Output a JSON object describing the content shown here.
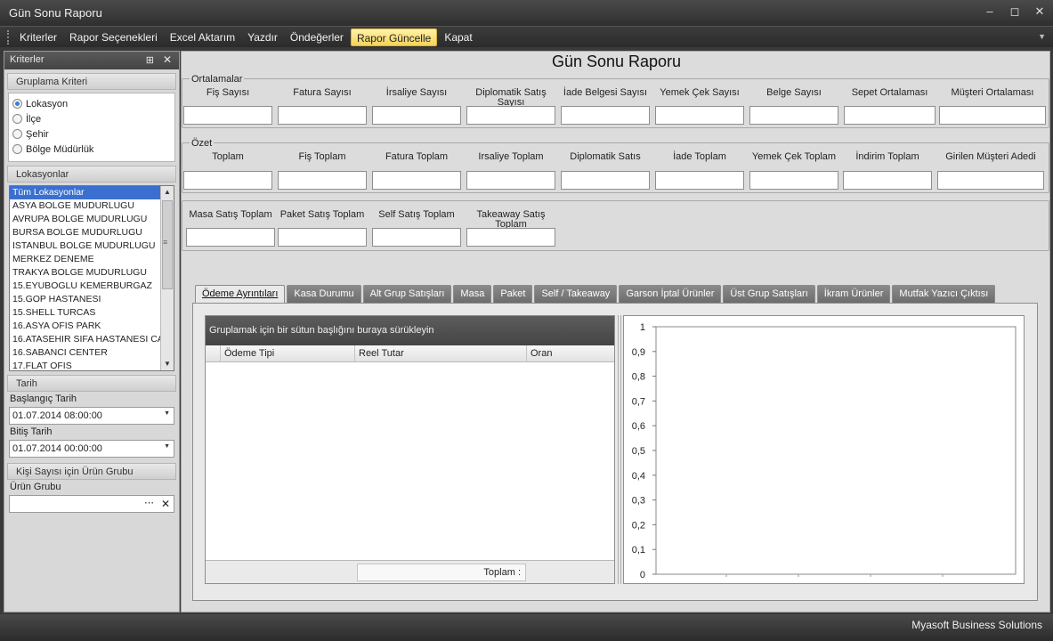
{
  "window": {
    "title": "Gün Sonu Raporu"
  },
  "menu": [
    "Kriterler",
    "Rapor Seçenekleri",
    "Excel Aktarım",
    "Yazdır",
    "Öndeğerler",
    "Rapor Güncelle",
    "Kapat"
  ],
  "menu_active": "Rapor Güncelle",
  "left_panel": {
    "title": "Kriterler",
    "grouping": {
      "title": "Gruplama Kriteri",
      "options": [
        "Lokasyon",
        "İlçe",
        "Şehir",
        "Bölge Müdürlük"
      ],
      "selected": "Lokasyon"
    },
    "locations": {
      "title": "Lokasyonlar",
      "items": [
        "Tüm Lokasyonlar",
        "ASYA BOLGE MUDURLUGU",
        "AVRUPA BOLGE MUDURLUGU",
        "BURSA BOLGE MUDURLUGU",
        "ISTANBUL BOLGE MUDURLUGU",
        "MERKEZ DENEME",
        "TRAKYA BOLGE MUDURLUGU",
        "15.EYUBOGLU KEMERBURGAZ",
        "15.GOP HASTANESI",
        "15.SHELL TURCAS",
        "16.ASYA OFIS PARK",
        "16.ATASEHIR SIFA HASTANESI CA",
        "16.SABANCI CENTER",
        "17.FLAT OFIS"
      ],
      "selected": "Tüm Lokasyonlar"
    },
    "date": {
      "title": "Tarih",
      "start_label": "Başlangıç Tarih",
      "start_value": "01.07.2014 08:00:00",
      "end_label": "Bitiş Tarih",
      "end_value": "01.07.2014 00:00:00"
    },
    "product_group": {
      "title": "Kişi Sayısı için Ürün Grubu",
      "label": "Ürün Grubu",
      "value": ""
    }
  },
  "report": {
    "title": "Gün Sonu Raporu",
    "averages": {
      "legend": "Ortalamalar",
      "fields": [
        "Fiş Sayısı",
        "Fatura Sayısı",
        "İrsaliye Sayısı",
        "Diplomatik Satış Sayısı",
        "İade Belgesi Sayısı",
        "Yemek Çek Sayısı",
        "Belge Sayısı",
        "Sepet Ortalaması",
        "Müşteri Ortalaması"
      ],
      "values": [
        "",
        "",
        "",
        "",
        "",
        "",
        "",
        "",
        ""
      ]
    },
    "summary": {
      "legend": "Özet",
      "fields": [
        "Toplam",
        "Fiş Toplam",
        "Fatura Toplam",
        "Irsaliye Toplam",
        "Diplomatik Satıs",
        "İade Toplam",
        "Yemek Çek Toplam",
        "İndirim Toplam",
        "Girilen Müşteri Adedi"
      ],
      "values": [
        "",
        "",
        "",
        "",
        "",
        "",
        "",
        "",
        ""
      ]
    },
    "sales": {
      "fields": [
        "Masa Satış Toplam",
        "Paket Satış Toplam",
        "Self Satış Toplam",
        "Takeaway Satış Toplam"
      ],
      "values": [
        "",
        "",
        "",
        ""
      ]
    }
  },
  "tabs": [
    "Ödeme Ayrıntıları",
    "Kasa Durumu",
    "Alt Grup Satışları",
    "Masa",
    "Paket",
    "Self / Takeaway",
    "Garson İptal Ürünler",
    "Üst Grup Satışları",
    "İkram Ürünler",
    "Mutfak Yazıcı Çıktısı"
  ],
  "active_tab": "Ödeme Ayrıntıları",
  "grid": {
    "group_hint": "Gruplamak için bir sütun başlığını buraya sürükleyin",
    "columns": [
      "Ödeme Tipi",
      "Reel Tutar",
      "Oran"
    ],
    "rows": [],
    "footer_label": "Toplam :"
  },
  "chart_data": {
    "type": "bar",
    "categories": [],
    "series": [],
    "ylim": [
      0,
      1
    ],
    "yticks": [
      "0",
      "0,1",
      "0,2",
      "0,3",
      "0,4",
      "0,5",
      "0,6",
      "0,7",
      "0,8",
      "0,9",
      "1"
    ],
    "grid": false
  },
  "status": {
    "text": "Myasoft Business Solutions"
  }
}
